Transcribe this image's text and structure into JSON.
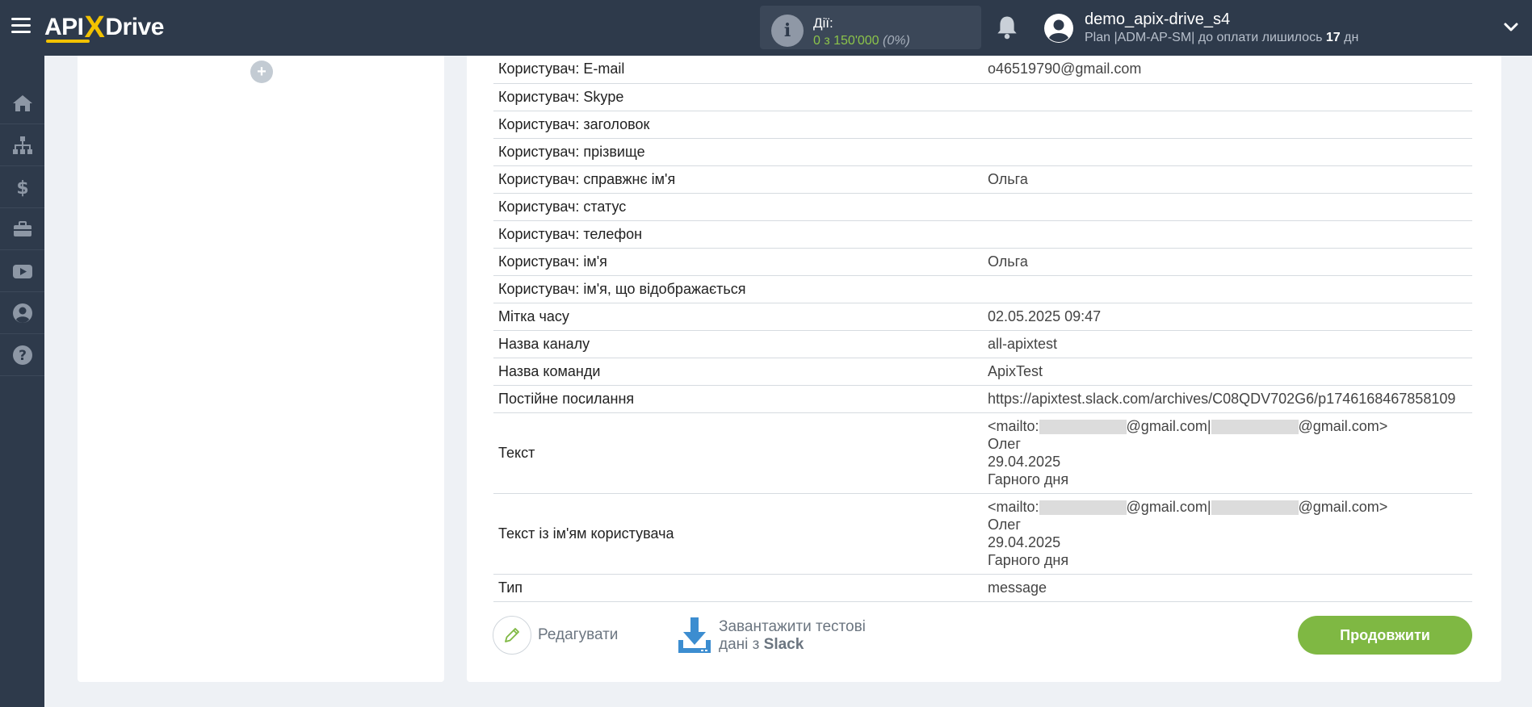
{
  "header": {
    "logo": {
      "api": "API",
      "x": "X",
      "drive": "Drive"
    },
    "actions": {
      "label": "Дії:",
      "count": "0 з 150'000",
      "percent": "(0%)"
    },
    "user": {
      "name": "demo_apix-drive_s4",
      "plan_prefix": "Plan |ADM-AP-SM| до оплати лишилось ",
      "days": "17",
      "days_suffix": " дн"
    }
  },
  "sidebar": {
    "items": [
      {
        "icon": "home-icon"
      },
      {
        "icon": "sitemap-icon"
      },
      {
        "icon": "dollar-icon"
      },
      {
        "icon": "briefcase-icon"
      },
      {
        "icon": "youtube-icon"
      },
      {
        "icon": "user-circle-icon"
      },
      {
        "icon": "help-icon"
      }
    ]
  },
  "left_panel": {
    "add_button": "+"
  },
  "fields": [
    {
      "key": "Користувач: E-mail",
      "value": "o46519790@gmail.com"
    },
    {
      "key": "Користувач: Skype",
      "value": ""
    },
    {
      "key": "Користувач: заголовок",
      "value": ""
    },
    {
      "key": "Користувач: прізвище",
      "value": ""
    },
    {
      "key": "Користувач: справжнє ім'я",
      "value": "Ольга"
    },
    {
      "key": "Користувач: статус",
      "value": ""
    },
    {
      "key": "Користувач: телефон",
      "value": ""
    },
    {
      "key": "Користувач: ім'я",
      "value": "Ольга"
    },
    {
      "key": "Користувач: ім'я, що відображається",
      "value": ""
    },
    {
      "key": "Мітка часу",
      "value": "02.05.2025 09:47"
    },
    {
      "key": "Назва каналу",
      "value": "all-apixtest"
    },
    {
      "key": "Назва команди",
      "value": "ApixTest"
    },
    {
      "key": "Постійне посилання",
      "value": "https://apixtest.slack.com/archives/C08QDV702G6/p1746168467858109"
    }
  ],
  "text_fields": [
    {
      "key": "Текст",
      "mail_prefix": "<mailto:",
      "mail_mid": "@gmail.com|",
      "mail_suffix": "@gmail.com>",
      "line2": "Олег",
      "line3": "29.04.2025",
      "line4": "Гарного дня"
    },
    {
      "key": "Текст із ім'ям користувача",
      "mail_prefix": "<mailto:",
      "mail_mid": "@gmail.com|",
      "mail_suffix": "@gmail.com>",
      "line2": "Олег",
      "line3": "29.04.2025",
      "line4": "Гарного дня"
    }
  ],
  "last_field": {
    "key": "Тип",
    "value": "message"
  },
  "actions": {
    "edit_label": "Редагувати",
    "download_line1": "Завантажити тестові",
    "download_line2_prefix": "дані з ",
    "download_line2_bold": "Slack",
    "continue_label": "Продовжити"
  },
  "colors": {
    "topbar": "#2e3a4b",
    "accent_green": "#7fb843",
    "logo_yellow": "#f2c200",
    "download_blue": "#3c8dd0"
  }
}
